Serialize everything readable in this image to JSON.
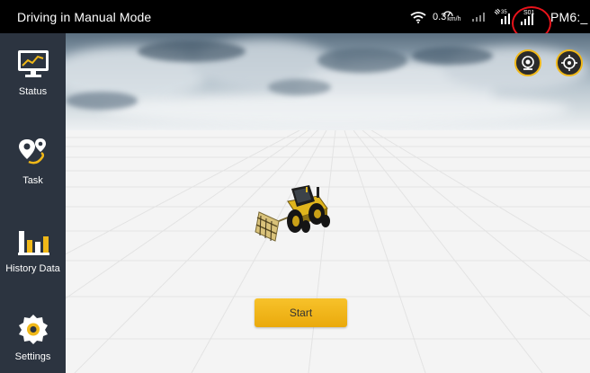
{
  "statusbar": {
    "mode_title": "Driving in Manual Mode",
    "speed_value": "0.3",
    "speed_unit": "km/h",
    "satellite_count": "35",
    "network_label": "S01",
    "time": "PM6:_",
    "highlight_color": "#e8131b"
  },
  "sidebar": {
    "background": "#2c3440",
    "items": [
      {
        "label": "Status",
        "icon": "monitor-chart-icon"
      },
      {
        "label": "Task",
        "icon": "route-pin-icon"
      },
      {
        "label": "History Data",
        "icon": "bar-chart-icon"
      },
      {
        "label": "Settings",
        "icon": "gear-icon"
      }
    ]
  },
  "scene": {
    "accent_color": "#f0b818",
    "buttons": [
      {
        "icon": "camera-icon"
      },
      {
        "icon": "crosshair-icon"
      }
    ],
    "start_label": "Start"
  }
}
